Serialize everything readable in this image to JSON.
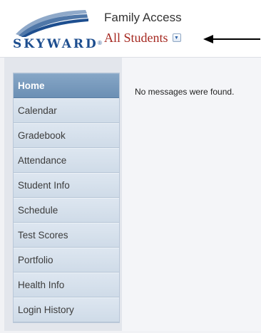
{
  "header": {
    "logo_text": "SKYWARD",
    "logo_mark": "®",
    "app_title": "Family Access",
    "student_selector": "All Students",
    "dropdown_icon": "chevron-down-icon"
  },
  "colors": {
    "student_text": "#a52820",
    "nav_active": "#7b9cbf",
    "nav_item": "#d6e0eb",
    "logo_blue": "#1d4e8f"
  },
  "sidebar": {
    "items": [
      {
        "label": "Home",
        "active": true
      },
      {
        "label": "Calendar"
      },
      {
        "label": "Gradebook"
      },
      {
        "label": "Attendance"
      },
      {
        "label": "Student Info"
      },
      {
        "label": "Schedule"
      },
      {
        "label": "Test Scores"
      },
      {
        "label": "Portfolio"
      },
      {
        "label": "Health Info"
      },
      {
        "label": "Login History"
      }
    ]
  },
  "main": {
    "message": "No messages were found."
  }
}
